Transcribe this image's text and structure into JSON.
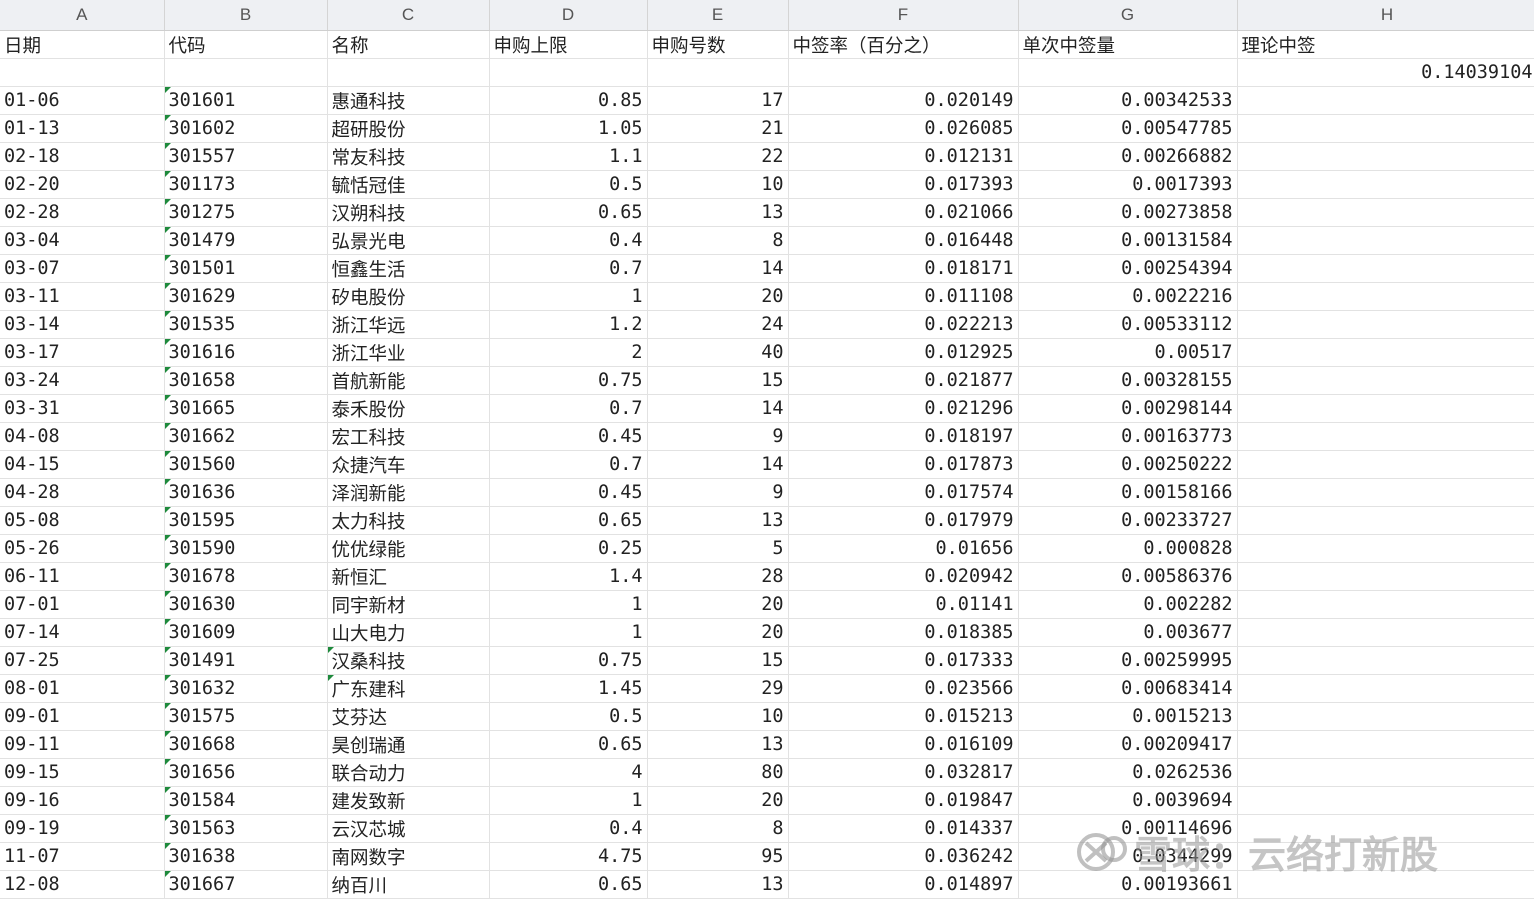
{
  "columns": [
    "A",
    "B",
    "C",
    "D",
    "E",
    "F",
    "G",
    "H"
  ],
  "headers": [
    "日期",
    "代码",
    "名称",
    "申购上限",
    "申购号数",
    "中签率（百分之）",
    "单次中签量",
    "理论中签"
  ],
  "total": "0.14039104",
  "rows": [
    [
      "01-06",
      "301601",
      "惠通科技",
      "0.85",
      "17",
      "0.020149",
      "0.00342533"
    ],
    [
      "01-13",
      "301602",
      "超研股份",
      "1.05",
      "21",
      "0.026085",
      "0.00547785"
    ],
    [
      "02-18",
      "301557",
      "常友科技",
      "1.1",
      "22",
      "0.012131",
      "0.00266882"
    ],
    [
      "02-20",
      "301173",
      "毓恬冠佳",
      "0.5",
      "10",
      "0.017393",
      "0.0017393"
    ],
    [
      "02-28",
      "301275",
      "汉朔科技",
      "0.65",
      "13",
      "0.021066",
      "0.00273858"
    ],
    [
      "03-04",
      "301479",
      "弘景光电",
      "0.4",
      "8",
      "0.016448",
      "0.00131584"
    ],
    [
      "03-07",
      "301501",
      "恒鑫生活",
      "0.7",
      "14",
      "0.018171",
      "0.00254394"
    ],
    [
      "03-11",
      "301629",
      "矽电股份",
      "1",
      "20",
      "0.011108",
      "0.0022216"
    ],
    [
      "03-14",
      "301535",
      "浙江华远",
      "1.2",
      "24",
      "0.022213",
      "0.00533112"
    ],
    [
      "03-17",
      "301616",
      "浙江华业",
      "2",
      "40",
      "0.012925",
      "0.00517"
    ],
    [
      "03-24",
      "301658",
      "首航新能",
      "0.75",
      "15",
      "0.021877",
      "0.00328155"
    ],
    [
      "03-31",
      "301665",
      "泰禾股份",
      "0.7",
      "14",
      "0.021296",
      "0.00298144"
    ],
    [
      "04-08",
      "301662",
      "宏工科技",
      "0.45",
      "9",
      "0.018197",
      "0.00163773"
    ],
    [
      "04-15",
      "301560",
      "众捷汽车",
      "0.7",
      "14",
      "0.017873",
      "0.00250222"
    ],
    [
      "04-28",
      "301636",
      "泽润新能",
      "0.45",
      "9",
      "0.017574",
      "0.00158166"
    ],
    [
      "05-08",
      "301595",
      "太力科技",
      "0.65",
      "13",
      "0.017979",
      "0.00233727"
    ],
    [
      "05-26",
      "301590",
      "优优绿能",
      "0.25",
      "5",
      "0.01656",
      "0.000828"
    ],
    [
      "06-11",
      "301678",
      "新恒汇",
      "1.4",
      "28",
      "0.020942",
      "0.00586376"
    ],
    [
      "07-01",
      "301630",
      "同宇新材",
      "1",
      "20",
      "0.01141",
      "0.002282"
    ],
    [
      "07-14",
      "301609",
      "山大电力",
      "1",
      "20",
      "0.018385",
      "0.003677"
    ],
    [
      "07-25",
      "301491",
      "汉桑科技",
      "0.75",
      "15",
      "0.017333",
      "0.00259995"
    ],
    [
      "08-01",
      "301632",
      "广东建科",
      "1.45",
      "29",
      "0.023566",
      "0.00683414"
    ],
    [
      "09-01",
      "301575",
      "艾芬达",
      "0.5",
      "10",
      "0.015213",
      "0.0015213"
    ],
    [
      "09-11",
      "301668",
      "昊创瑞通",
      "0.65",
      "13",
      "0.016109",
      "0.00209417"
    ],
    [
      "09-15",
      "301656",
      "联合动力",
      "4",
      "80",
      "0.032817",
      "0.0262536"
    ],
    [
      "09-16",
      "301584",
      "建发致新",
      "1",
      "20",
      "0.019847",
      "0.0039694"
    ],
    [
      "09-19",
      "301563",
      "云汉芯城",
      "0.4",
      "8",
      "0.014337",
      "0.00114696"
    ],
    [
      "11-07",
      "301638",
      "南网数字",
      "4.75",
      "95",
      "0.036242",
      "0.0344299"
    ],
    [
      "12-08",
      "301667",
      "纳百川",
      "0.65",
      "13",
      "0.014897",
      "0.00193661"
    ]
  ],
  "watermark": {
    "text": "雪球：云络打新股",
    "icon": "snowball-logo-icon"
  }
}
